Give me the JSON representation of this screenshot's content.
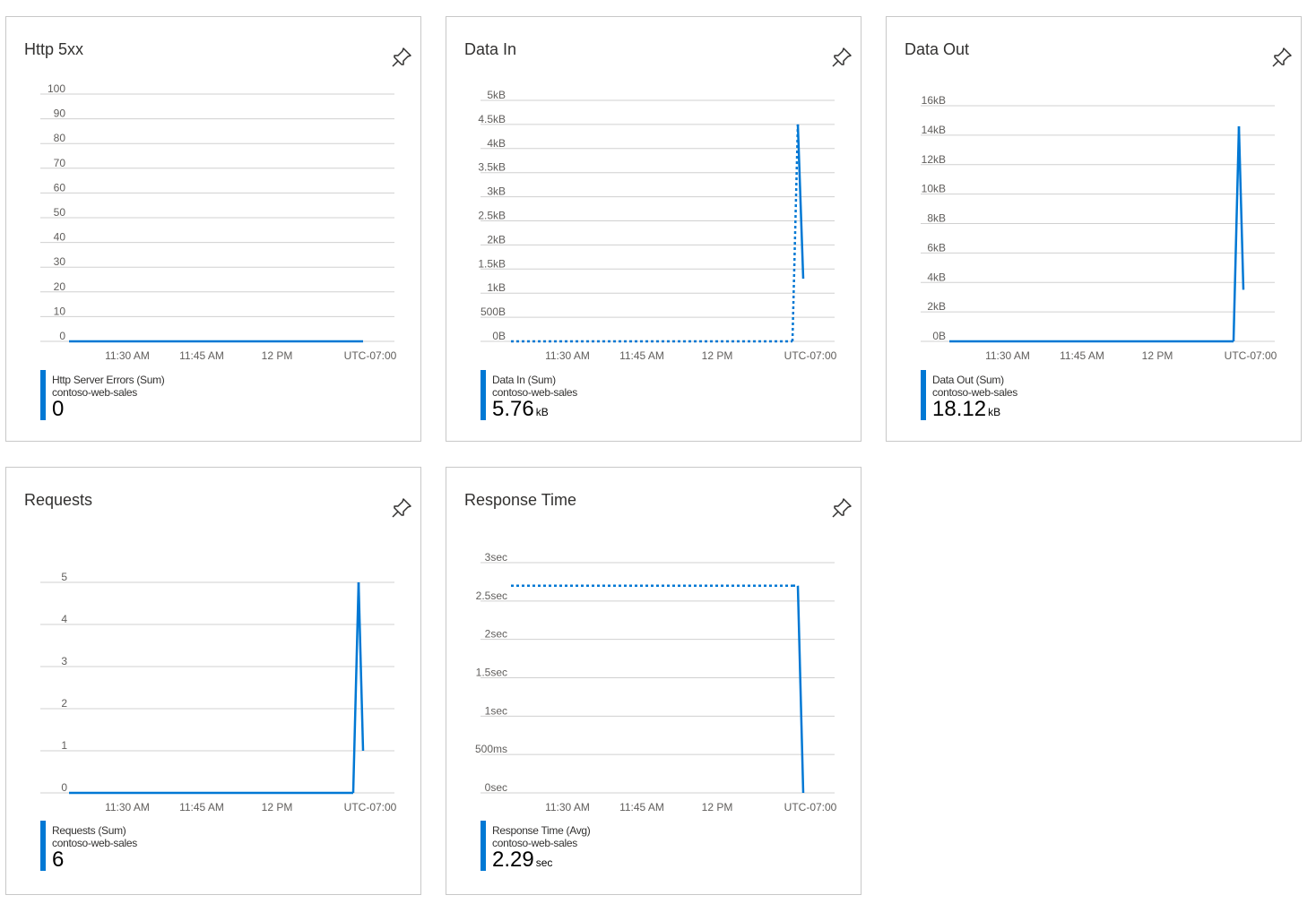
{
  "accent_color": "#0078d4",
  "x_axis_labels": [
    "11:30 AM",
    "11:45 AM",
    "12 PM",
    "UTC-07:00"
  ],
  "cards": [
    {
      "title": "Http 5xx",
      "pin_icon": "pin-icon",
      "y_ticks": [
        "100",
        "90",
        "80",
        "70",
        "60",
        "50",
        "40",
        "30",
        "20",
        "10",
        "0"
      ],
      "legend": {
        "metric": "Http Server Errors (Sum)",
        "resource": "contoso-web-sales",
        "value": "0",
        "unit": ""
      },
      "chart_data": {
        "type": "line",
        "ylim": [
          0,
          100
        ],
        "series": [
          {
            "name": "Http Server Errors (Sum)",
            "values": [
              0,
              0
            ]
          }
        ]
      }
    },
    {
      "title": "Data In",
      "pin_icon": "pin-icon",
      "y_ticks": [
        "5kB",
        "4.5kB",
        "4kB",
        "3.5kB",
        "3kB",
        "2.5kB",
        "2kB",
        "1.5kB",
        "1kB",
        "500B",
        "0B"
      ],
      "legend": {
        "metric": "Data In (Sum)",
        "resource": "contoso-web-sales",
        "value": "5.76",
        "unit": "kB"
      },
      "chart_data": {
        "type": "line",
        "ylim": [
          0,
          5000
        ],
        "series": [
          {
            "name": "Data In (Sum)",
            "values": [
              0,
              0,
              4500,
              1300
            ]
          }
        ]
      }
    },
    {
      "title": "Data Out",
      "pin_icon": "pin-icon",
      "y_ticks": [
        "16kB",
        "14kB",
        "12kB",
        "10kB",
        "8kB",
        "6kB",
        "4kB",
        "2kB",
        "0B"
      ],
      "legend": {
        "metric": "Data Out (Sum)",
        "resource": "contoso-web-sales",
        "value": "18.12",
        "unit": "kB"
      },
      "chart_data": {
        "type": "line",
        "ylim": [
          0,
          16000
        ],
        "series": [
          {
            "name": "Data Out (Sum)",
            "values": [
              0,
              0,
              14600,
              3500
            ]
          }
        ]
      }
    },
    {
      "title": "Requests",
      "pin_icon": "pin-icon",
      "y_ticks": [
        "5",
        "4",
        "3",
        "2",
        "1",
        "0"
      ],
      "legend": {
        "metric": "Requests (Sum)",
        "resource": "contoso-web-sales",
        "value": "6",
        "unit": ""
      },
      "chart_data": {
        "type": "line",
        "ylim": [
          0,
          5
        ],
        "series": [
          {
            "name": "Requests (Sum)",
            "values": [
              0,
              0,
              5,
              1
            ]
          }
        ]
      }
    },
    {
      "title": "Response Time",
      "pin_icon": "pin-icon",
      "y_ticks": [
        "3sec",
        "2.5sec",
        "2sec",
        "1.5sec",
        "1sec",
        "500ms",
        "0sec"
      ],
      "legend": {
        "metric": "Response Time (Avg)",
        "resource": "contoso-web-sales",
        "value": "2.29",
        "unit": "sec"
      },
      "chart_data": {
        "type": "line",
        "ylim": [
          0,
          3
        ],
        "series": [
          {
            "name": "Response Time (Avg)",
            "values": [
              2.7,
              2.7,
              2.7,
              0
            ]
          }
        ]
      }
    }
  ]
}
